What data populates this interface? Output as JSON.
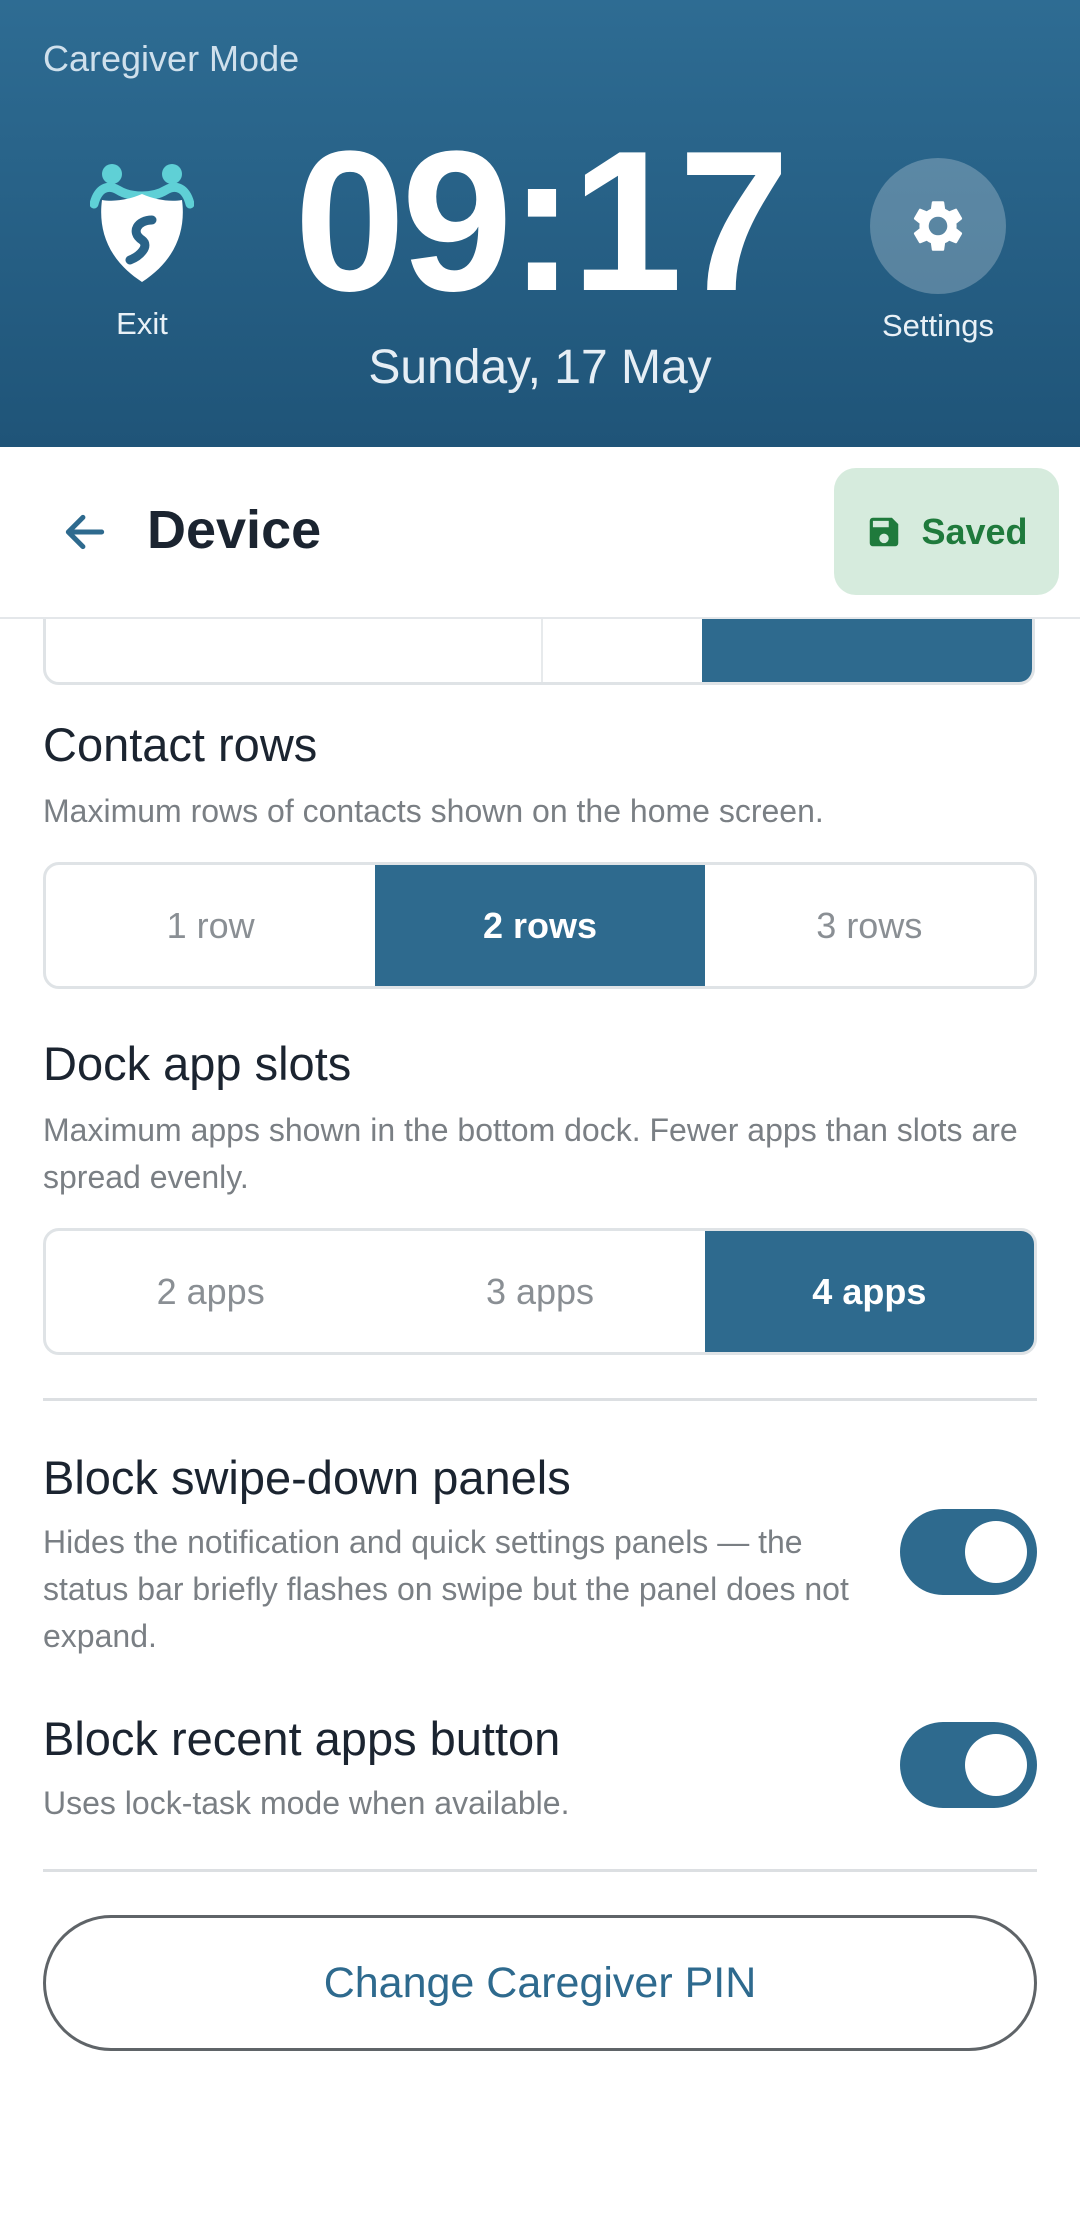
{
  "header": {
    "mode_label": "Caregiver Mode",
    "exit_label": "Exit",
    "time": "09:17",
    "date": "Sunday, 17 May",
    "settings_label": "Settings",
    "exit_icon": "shield-people-icon",
    "settings_icon": "gear-icon",
    "bg_color": "#2a6388"
  },
  "toolbar": {
    "back_icon": "arrow-left-icon",
    "title": "Device",
    "saved_label": "Saved",
    "saved_icon": "save-icon"
  },
  "contact_rows": {
    "title": "Contact rows",
    "description": "Maximum rows of contacts shown on the home screen.",
    "options": [
      "1 row",
      "2 rows",
      "3 rows"
    ],
    "selected": "2 rows"
  },
  "dock_slots": {
    "title": "Dock app slots",
    "description": "Maximum apps shown in the bottom dock. Fewer apps than slots are spread evenly.",
    "options": [
      "2 apps",
      "3 apps",
      "4 apps"
    ],
    "selected": "4 apps"
  },
  "block_swipe": {
    "title": "Block swipe-down panels",
    "description": "Hides the notification and quick settings panels — the status bar briefly flashes on swipe but the panel does not expand.",
    "enabled": true
  },
  "block_recents": {
    "title": "Block recent apps button",
    "description": "Uses lock-task mode when available.",
    "enabled": true
  },
  "pin_button_label": "Change Caregiver PIN",
  "colors": {
    "accent": "#2e6a8e",
    "saved_bg": "#d6ebdd",
    "saved_text": "#1f7a3c"
  }
}
